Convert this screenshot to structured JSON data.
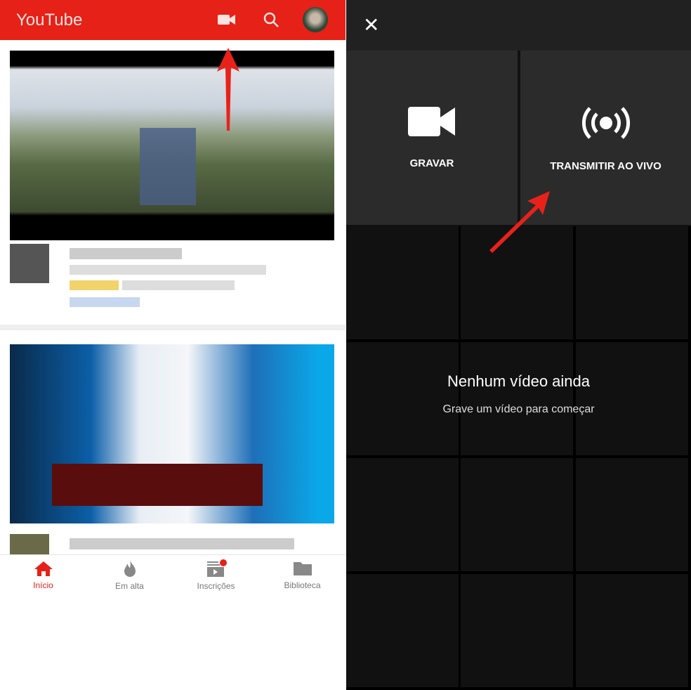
{
  "left": {
    "header": {
      "title": "YouTube",
      "icons": [
        "video-camera-icon",
        "search-icon",
        "avatar"
      ]
    },
    "nav": [
      {
        "label": "Início",
        "icon": "home-icon",
        "active": true
      },
      {
        "label": "Em alta",
        "icon": "flame-icon",
        "active": false
      },
      {
        "label": "Inscrições",
        "icon": "subscriptions-icon",
        "active": false,
        "badge": true
      },
      {
        "label": "Biblioteca",
        "icon": "folder-icon",
        "active": false
      }
    ]
  },
  "right": {
    "close_icon": "close-icon",
    "record_label": "GRAVAR",
    "live_label": "TRANSMITIR AO VIVO",
    "empty_title": "Nenhum vídeo ainda",
    "empty_subtitle": "Grave um vídeo para começar"
  },
  "colors": {
    "brand": "#e62117",
    "annotation_arrow": "#e8221b"
  }
}
